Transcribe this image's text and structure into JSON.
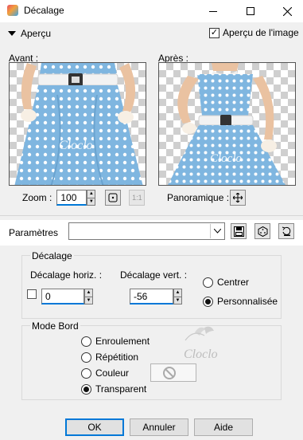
{
  "window": {
    "title": "Décalage",
    "icon": "app-icon"
  },
  "preview": {
    "toggle_label": "Aperçu",
    "show_on_image_label": "Aperçu de l'image",
    "show_on_image_checked": true,
    "before_label": "Avant :",
    "after_label": "Après :",
    "watermark_text": "Cloclo"
  },
  "zoom": {
    "label": "Zoom :",
    "value": "100"
  },
  "pan": {
    "label": "Panoramique :"
  },
  "presets": {
    "label": "Paramètres",
    "value": ""
  },
  "offset": {
    "group_label": "Décalage",
    "horiz_label": "Décalage horiz. :",
    "horiz_value": "0",
    "vert_label": "Décalage vert. :",
    "vert_value": "-56",
    "center_label": "Centrer",
    "custom_label": "Personnalisée",
    "selected": "custom"
  },
  "edge_mode": {
    "group_label": "Mode Bord",
    "options": [
      "Enroulement",
      "Répétition",
      "Couleur",
      "Transparent"
    ],
    "selected": "Transparent"
  },
  "buttons": {
    "ok": "OK",
    "cancel": "Annuler",
    "help": "Aide"
  },
  "colors": {
    "accent": "#0078d7",
    "dress": "#7fb6e0"
  }
}
